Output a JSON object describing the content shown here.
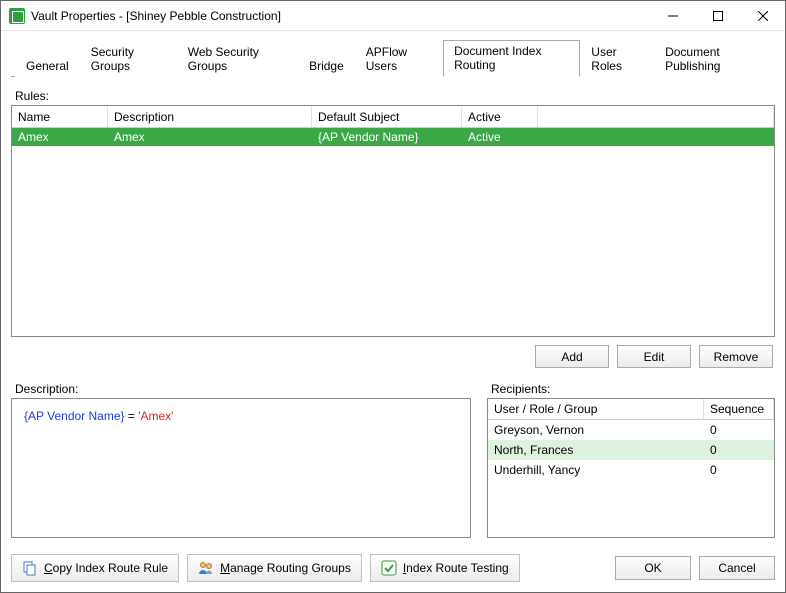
{
  "window": {
    "title": "Vault Properties - [Shiney Pebble Construction]"
  },
  "tabs": [
    {
      "label": "General"
    },
    {
      "label": "Security Groups"
    },
    {
      "label": "Web Security Groups"
    },
    {
      "label": "Bridge"
    },
    {
      "label": "APFlow Users"
    },
    {
      "label": "Document Index Routing",
      "active": true
    },
    {
      "label": "User Roles"
    },
    {
      "label": "Document Publishing"
    }
  ],
  "rules": {
    "label": "Rules:",
    "headers": {
      "name": "Name",
      "description": "Description",
      "default_subject": "Default Subject",
      "active": "Active"
    },
    "rows": [
      {
        "name": "Amex",
        "description": "Amex",
        "default_subject": "{AP Vendor Name}",
        "active": "Active",
        "selected": true
      }
    ],
    "buttons": {
      "add": "Add",
      "edit": "Edit",
      "remove": "Remove"
    }
  },
  "description": {
    "label": "Description:",
    "field": "{AP Vendor Name}",
    "op": " = ",
    "value": "'Amex'"
  },
  "recipients": {
    "label": "Recipients:",
    "headers": {
      "user": "User / Role / Group",
      "sequence": "Sequence"
    },
    "rows": [
      {
        "user": "Greyson, Vernon",
        "sequence": "0"
      },
      {
        "user": "North, Frances",
        "sequence": "0",
        "highlight": true
      },
      {
        "user": "Underhill, Yancy",
        "sequence": "0"
      }
    ]
  },
  "toolbar": {
    "copy": "Copy Index Route Rule",
    "manage": "Manage Routing Groups",
    "test": "Index Route Testing"
  },
  "dialog": {
    "ok": "OK",
    "cancel": "Cancel"
  }
}
